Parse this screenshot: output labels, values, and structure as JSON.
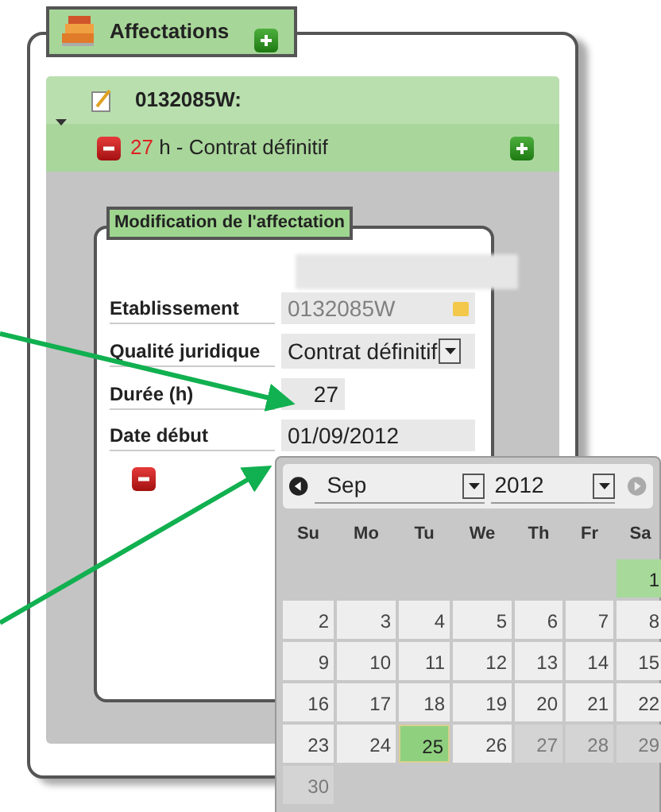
{
  "section": {
    "title": "Affectations"
  },
  "group": {
    "code": "0132085W:",
    "expanded": true,
    "entry": {
      "hours": "27",
      "unit": "h -",
      "label": "Contrat définitif"
    }
  },
  "dialog": {
    "title": "Modification de l'affectation",
    "fields": [
      {
        "label": "Etablissement",
        "kind": "lookup",
        "value": "0132085W"
      },
      {
        "label": "Qualité juridique",
        "kind": "select",
        "value": "Contrat définitif"
      },
      {
        "label": "Durée (h)",
        "kind": "number",
        "value": "27"
      },
      {
        "label": "Date début",
        "kind": "date",
        "value": "01/09/2012"
      }
    ]
  },
  "calendar": {
    "month": "Sep",
    "year": "2012",
    "weekdays": [
      "Su",
      "Mo",
      "Tu",
      "We",
      "Th",
      "Fr",
      "Sa"
    ],
    "days": [
      {
        "label": "1",
        "selected": true,
        "today": false,
        "disabled": false
      },
      {
        "label": "2",
        "selected": false,
        "today": false,
        "disabled": false
      },
      {
        "label": "3",
        "selected": false,
        "today": false,
        "disabled": false
      },
      {
        "label": "4",
        "selected": false,
        "today": false,
        "disabled": false
      },
      {
        "label": "5",
        "selected": false,
        "today": false,
        "disabled": false
      },
      {
        "label": "6",
        "selected": false,
        "today": false,
        "disabled": false
      },
      {
        "label": "7",
        "selected": false,
        "today": false,
        "disabled": false
      },
      {
        "label": "8",
        "selected": false,
        "today": false,
        "disabled": false
      },
      {
        "label": "9",
        "selected": false,
        "today": false,
        "disabled": false
      },
      {
        "label": "10",
        "selected": false,
        "today": false,
        "disabled": false
      },
      {
        "label": "11",
        "selected": false,
        "today": false,
        "disabled": false
      },
      {
        "label": "12",
        "selected": false,
        "today": false,
        "disabled": false
      },
      {
        "label": "13",
        "selected": false,
        "today": false,
        "disabled": false
      },
      {
        "label": "14",
        "selected": false,
        "today": false,
        "disabled": false
      },
      {
        "label": "15",
        "selected": false,
        "today": false,
        "disabled": false
      },
      {
        "label": "16",
        "selected": false,
        "today": false,
        "disabled": false
      },
      {
        "label": "17",
        "selected": false,
        "today": false,
        "disabled": false
      },
      {
        "label": "18",
        "selected": false,
        "today": false,
        "disabled": false
      },
      {
        "label": "19",
        "selected": false,
        "today": false,
        "disabled": false
      },
      {
        "label": "20",
        "selected": false,
        "today": false,
        "disabled": false
      },
      {
        "label": "21",
        "selected": false,
        "today": false,
        "disabled": false
      },
      {
        "label": "22",
        "selected": false,
        "today": false,
        "disabled": false
      },
      {
        "label": "23",
        "selected": false,
        "today": false,
        "disabled": false
      },
      {
        "label": "24",
        "selected": false,
        "today": false,
        "disabled": false
      },
      {
        "label": "25",
        "selected": false,
        "today": true,
        "disabled": false
      },
      {
        "label": "26",
        "selected": false,
        "today": false,
        "disabled": false
      },
      {
        "label": "27",
        "selected": false,
        "today": false,
        "disabled": true
      },
      {
        "label": "28",
        "selected": false,
        "today": false,
        "disabled": true
      },
      {
        "label": "29",
        "selected": false,
        "today": false,
        "disabled": true
      },
      {
        "label": "30",
        "selected": false,
        "today": false,
        "disabled": true
      }
    ]
  }
}
